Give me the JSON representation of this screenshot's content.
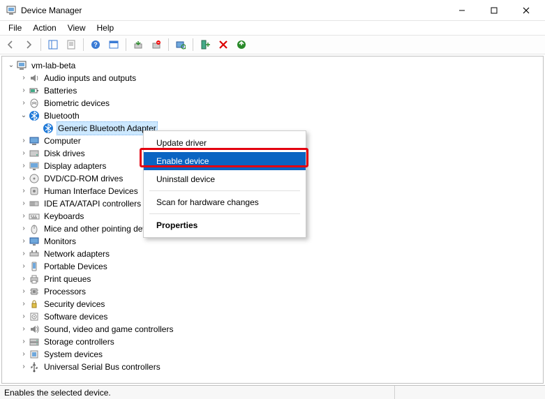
{
  "window": {
    "title": "Device Manager"
  },
  "menubar": {
    "file": "File",
    "action": "Action",
    "view": "View",
    "help": "Help"
  },
  "tree": {
    "root": "vm-lab-beta",
    "items": [
      {
        "label": "Audio inputs and outputs",
        "icon": "audio-icon"
      },
      {
        "label": "Batteries",
        "icon": "battery-icon"
      },
      {
        "label": "Biometric devices",
        "icon": "biometric-icon"
      },
      {
        "label": "Bluetooth",
        "icon": "bluetooth-icon",
        "expanded": true,
        "child": {
          "label": "Generic Bluetooth Adapter",
          "icon": "bluetooth-icon",
          "selected": true
        }
      },
      {
        "label": "Computer",
        "icon": "computer-icon"
      },
      {
        "label": "Disk drives",
        "icon": "disk-icon"
      },
      {
        "label": "Display adapters",
        "icon": "display-icon"
      },
      {
        "label": "DVD/CD-ROM drives",
        "icon": "optical-icon"
      },
      {
        "label": "Human Interface Devices",
        "icon": "hid-icon"
      },
      {
        "label": "IDE ATA/ATAPI controllers",
        "icon": "ide-icon"
      },
      {
        "label": "Keyboards",
        "icon": "keyboard-icon"
      },
      {
        "label": "Mice and other pointing devices",
        "icon": "mouse-icon"
      },
      {
        "label": "Monitors",
        "icon": "monitor-icon"
      },
      {
        "label": "Network adapters",
        "icon": "network-icon"
      },
      {
        "label": "Portable Devices",
        "icon": "portable-icon"
      },
      {
        "label": "Print queues",
        "icon": "printer-icon"
      },
      {
        "label": "Processors",
        "icon": "cpu-icon"
      },
      {
        "label": "Security devices",
        "icon": "security-icon"
      },
      {
        "label": "Software devices",
        "icon": "software-icon"
      },
      {
        "label": "Sound, video and game controllers",
        "icon": "sound-icon"
      },
      {
        "label": "Storage controllers",
        "icon": "storage-icon"
      },
      {
        "label": "System devices",
        "icon": "system-icon"
      },
      {
        "label": "Universal Serial Bus controllers",
        "icon": "usb-icon"
      }
    ]
  },
  "context_menu": {
    "update": "Update driver",
    "enable": "Enable device",
    "uninstall": "Uninstall device",
    "scan": "Scan for hardware changes",
    "properties": "Properties"
  },
  "statusbar": {
    "text": "Enables the selected device."
  }
}
